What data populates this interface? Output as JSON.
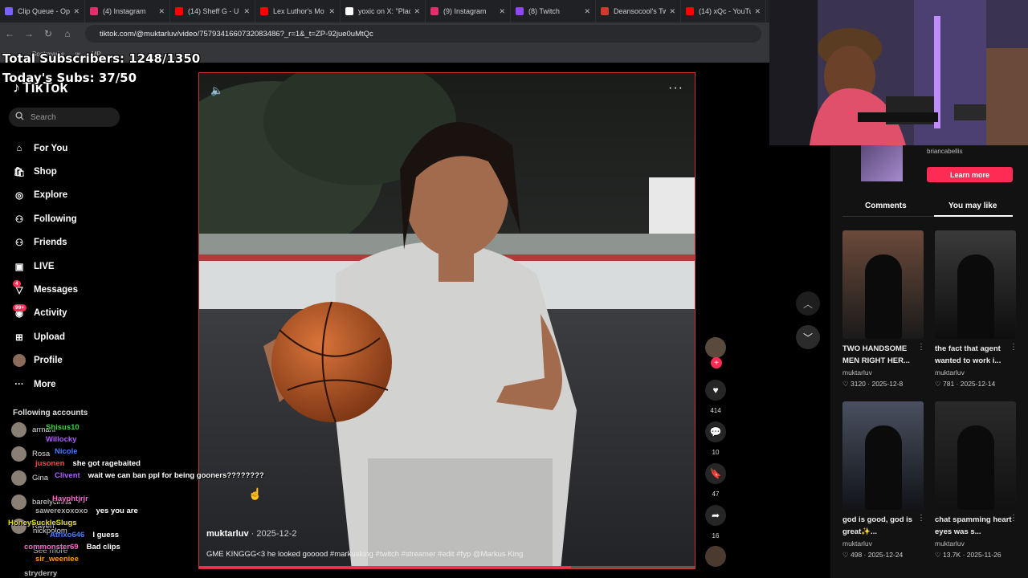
{
  "browser": {
    "tabs": [
      {
        "title": "Clip Queue - Op",
        "color": "#7b61ff"
      },
      {
        "title": "(4) Instagram",
        "color": "#e1306c"
      },
      {
        "title": "(14) Sheff G - U",
        "color": "#ff0000"
      },
      {
        "title": "Lex Luthor's Mo",
        "color": "#ff0000"
      },
      {
        "title": "yoxic on X: \"Plac",
        "color": "#ffffff"
      },
      {
        "title": "(9) Instagram",
        "color": "#e1306c"
      },
      {
        "title": "(8) Twitch",
        "color": "#9146ff"
      },
      {
        "title": "Deansocool's Tw",
        "color": "#d13a2c"
      },
      {
        "title": "(14) xQc - YouTu",
        "color": "#ff0000"
      }
    ],
    "url": "tiktok.com/@muktarluv/video/7579341660732083486?_r=1&_t=ZP-92jue0uMtQc",
    "bookmarks": [
      "Bookmarks",
      "w",
      "MP"
    ]
  },
  "overlay": {
    "total_subs": "Total Subscribers: 1248/1350",
    "today_subs": "Today's Subs: 37/50"
  },
  "sidebar": {
    "logo": "TikTok",
    "search_placeholder": "Search",
    "nav": [
      {
        "label": "For You",
        "icon": "home-icon"
      },
      {
        "label": "Shop",
        "icon": "shop-icon"
      },
      {
        "label": "Explore",
        "icon": "compass-icon"
      },
      {
        "label": "Following",
        "icon": "following-icon"
      },
      {
        "label": "Friends",
        "icon": "friends-icon"
      },
      {
        "label": "LIVE",
        "icon": "live-icon"
      },
      {
        "label": "Messages",
        "icon": "messages-icon",
        "badge": "4"
      },
      {
        "label": "Activity",
        "icon": "activity-icon",
        "badge": "99+"
      },
      {
        "label": "Upload",
        "icon": "upload-icon"
      },
      {
        "label": "Profile",
        "icon": "profile-icon"
      },
      {
        "label": "More",
        "icon": "more-icon"
      }
    ],
    "following_label": "Following accounts",
    "accounts": [
      "armani",
      "Rosa",
      "Gina",
      "barelycinna",
      "Raven",
      "nickpolom"
    ],
    "see_more": "See more"
  },
  "chat": [
    {
      "user": "Shisus10",
      "color": "#3bd13b",
      "text": ""
    },
    {
      "user": "Willocky",
      "color": "#b05cff",
      "text": ""
    },
    {
      "user": "Nicole",
      "color": "#4a7cff",
      "text": ""
    },
    {
      "user": "jusonen",
      "color": "#ff4444",
      "text": "she got ragebaited"
    },
    {
      "user": "Clivent",
      "color": "#b05cff",
      "text": "wait we can ban ppl for being gooners????????"
    },
    {
      "user": "Hayphtjrjr",
      "color": "#ff66cc",
      "text": ""
    },
    {
      "user": "sawerexoxoxo",
      "color": "#aaaaaa",
      "text": "yes you are"
    },
    {
      "user": "HoneySuckleSlugs",
      "color": "#e6e600",
      "text": ""
    },
    {
      "user": "Atrixo646",
      "color": "#4a7cff",
      "text": "I guess"
    },
    {
      "user": "commonster69",
      "color": "#ff66cc",
      "text": "Bad clips"
    },
    {
      "user": "sir_weeniee",
      "color": "#ff9900",
      "text": ""
    },
    {
      "user": "stryderry",
      "color": "#bbbbbb",
      "text": ""
    }
  ],
  "video": {
    "author": "muktarluv",
    "date": "2025-12-2",
    "caption": "GME KINGGG<3 he looked gooood #markusking #twitch #streamer #edit #fyp @Markus King",
    "progress": 0.75
  },
  "actions": {
    "likes": "414",
    "comments": "10",
    "saves": "47",
    "shares": "16"
  },
  "right_panel": {
    "ad_account": "briancabellis",
    "learn_more": "Learn more",
    "tabs": [
      "Comments",
      "You may like"
    ],
    "active_tab": "You may like",
    "cards": [
      {
        "title": "TWO HANDSOME MEN RIGHT HER...",
        "user": "muktarluv",
        "likes": "3120",
        "date": "2025-12-8"
      },
      {
        "title": "the fact that agent wanted to work i...",
        "user": "muktarluv",
        "likes": "781",
        "date": "2025-12-14"
      },
      {
        "title": "god is good, god is great✨...",
        "user": "muktarluv",
        "likes": "498",
        "date": "2025-12-24"
      },
      {
        "title": "chat spamming heart eyes was s...",
        "user": "muktarluv",
        "likes": "13.7K",
        "date": "2025-11-26"
      }
    ]
  }
}
